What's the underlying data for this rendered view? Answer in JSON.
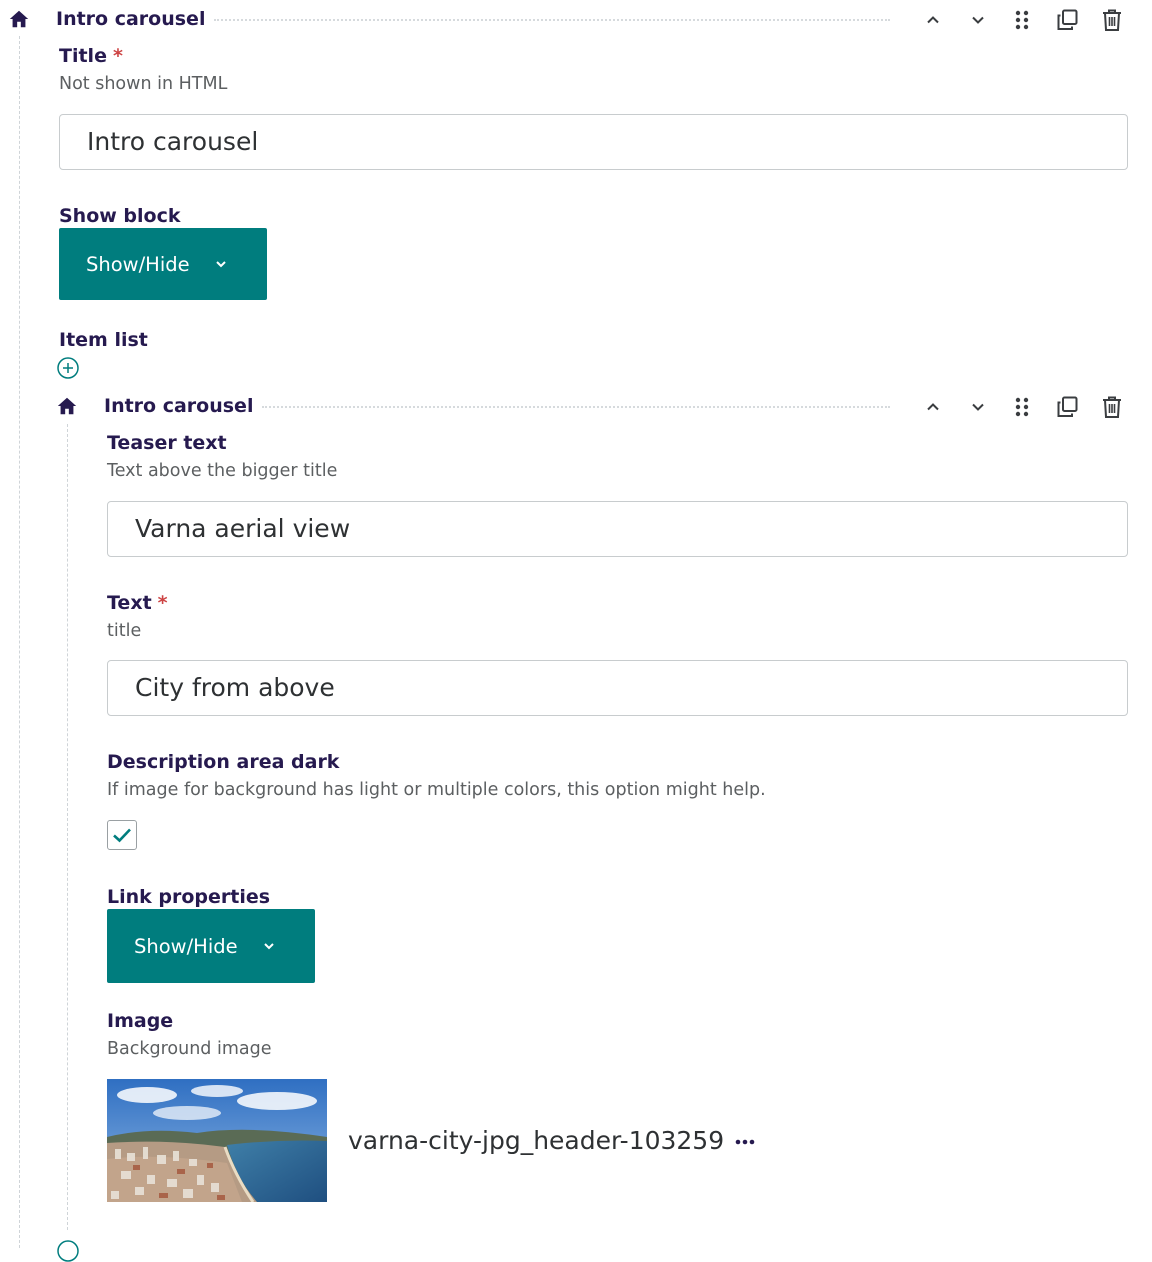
{
  "outer_block": {
    "title": "Intro carousel",
    "icon": "home-icon",
    "controls": [
      "move-up-icon",
      "move-down-icon",
      "drag-handle-icon",
      "duplicate-icon",
      "delete-icon"
    ]
  },
  "title_field": {
    "label": "Title",
    "required_mark": "*",
    "help": "Not shown in HTML",
    "value": "Intro carousel"
  },
  "show_block": {
    "label": "Show block",
    "button_label": "Show/Hide"
  },
  "item_list": {
    "label": "Item list",
    "add_icon": "add-circle-icon"
  },
  "inner_block": {
    "title": "Intro carousel",
    "icon": "home-icon",
    "teaser": {
      "label": "Teaser text",
      "help": "Text above the bigger title",
      "value": "Varna aerial view"
    },
    "text": {
      "label": "Text",
      "required_mark": "*",
      "help": "title",
      "value": "City from above"
    },
    "description_dark": {
      "label": "Description area dark",
      "help": "If image for background has light or multiple colors, this option might help.",
      "checked": true
    },
    "link_properties": {
      "label": "Link properties",
      "button_label": "Show/Hide"
    },
    "image": {
      "label": "Image",
      "help": "Background image",
      "filename": "varna-city-jpg_header-103259",
      "more_icon": "more-horizontal-icon"
    }
  },
  "colors": {
    "heading": "#261a4f",
    "accent": "#007d7e",
    "required": "#cd4444",
    "border": "#c8ccce"
  }
}
